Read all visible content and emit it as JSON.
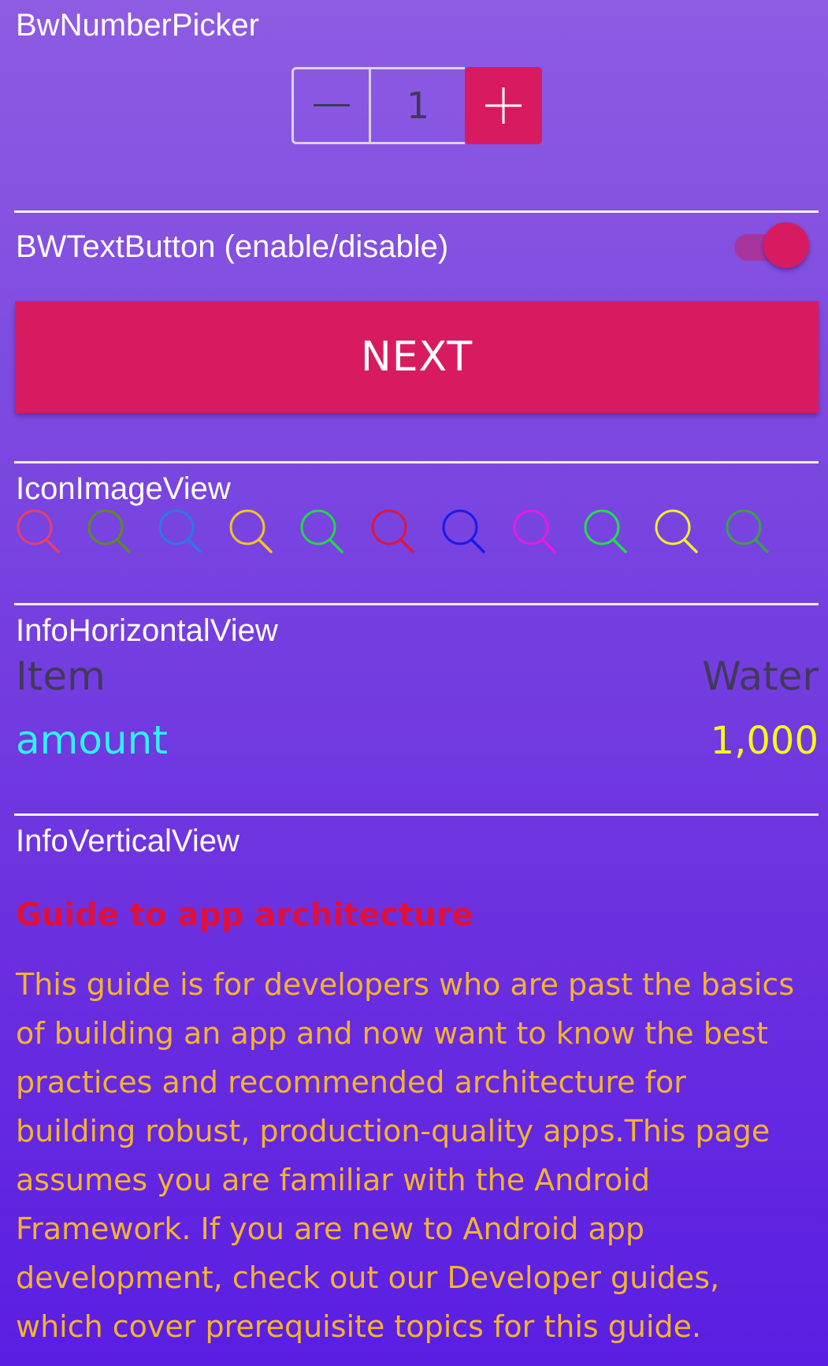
{
  "number_picker": {
    "section_label": "BwNumberPicker",
    "value": "1",
    "minus_icon": "minus-icon",
    "plus_icon": "plus-icon",
    "accent_color": "#d81b60"
  },
  "text_button": {
    "section_label": "BWTextButton (enable/disable)",
    "toggle_on": true,
    "button_label": "NEXT"
  },
  "icon_image_view": {
    "section_label": "IconImageView",
    "icons": [
      {
        "name": "search-icon",
        "color": "#e83e6b"
      },
      {
        "name": "search-icon",
        "color": "#5a8a2a"
      },
      {
        "name": "search-icon",
        "color": "#2a7ae0"
      },
      {
        "name": "search-icon",
        "color": "#f2c12e"
      },
      {
        "name": "search-icon",
        "color": "#21d64c"
      },
      {
        "name": "search-icon",
        "color": "#e0163a"
      },
      {
        "name": "search-icon",
        "color": "#1a1ae8"
      },
      {
        "name": "search-icon",
        "color": "#e81ae0"
      },
      {
        "name": "search-icon",
        "color": "#1ee04a"
      },
      {
        "name": "search-icon",
        "color": "#f2ee2e"
      },
      {
        "name": "search-icon",
        "color": "#3aa04a"
      }
    ]
  },
  "info_horizontal_view": {
    "section_label": "InfoHorizontalView",
    "rows": [
      {
        "label": "Item",
        "value": "Water"
      },
      {
        "label": "amount",
        "value": "1,000"
      }
    ]
  },
  "info_vertical_view": {
    "section_label": "InfoVerticalView",
    "title": "Guide to app architecture",
    "body": "This guide is for developers who are past the basics of building an app and now want to know the best practices and recommended architecture for building robust, production-quality apps.This page assumes you are familiar with the Android Framework. If you are new to Android app development, check out our Developer guides, which cover prerequisite topics for this guide."
  }
}
